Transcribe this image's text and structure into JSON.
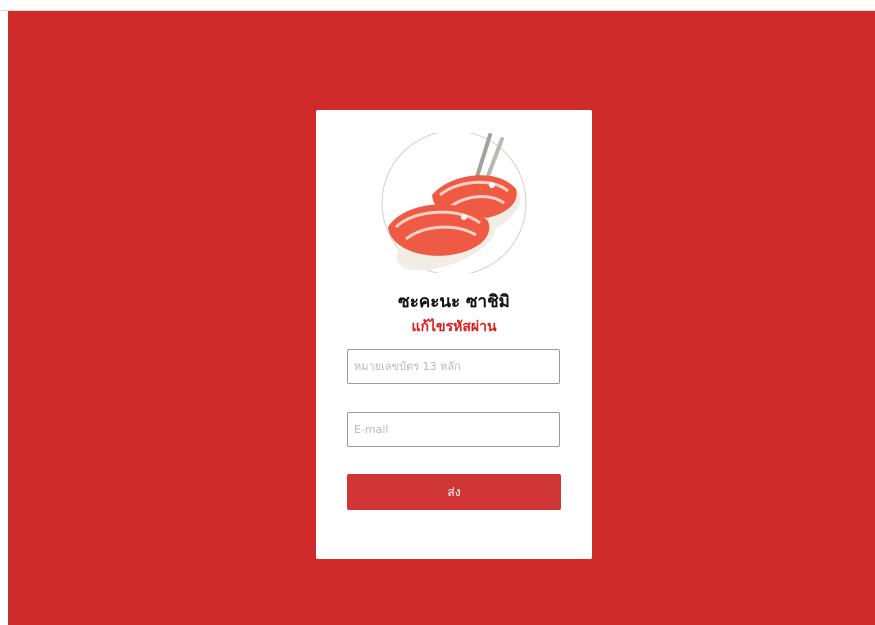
{
  "app": {
    "brand_name": "ซะคะนะ ซาชิมิ",
    "logo_icon": "sushi-chopsticks-icon",
    "colors": {
      "background": "#d02b2b",
      "accent_text": "#e11a1a",
      "button": "#d03535"
    }
  },
  "form": {
    "title": "แก้ไขรหัสผ่าน",
    "id_card": {
      "placeholder": "หมายเลขบัตร 13 หลัก",
      "value": ""
    },
    "email": {
      "placeholder": "E-mail",
      "value": ""
    },
    "submit_label": "ส่ง"
  }
}
